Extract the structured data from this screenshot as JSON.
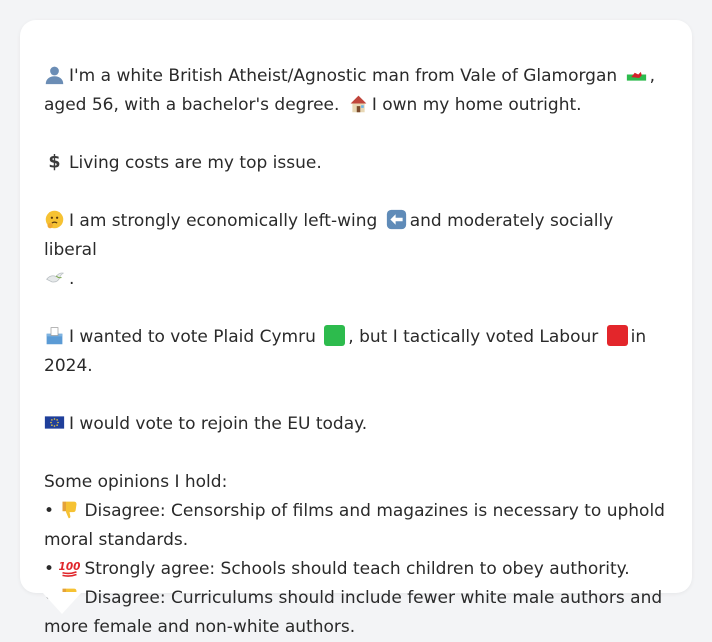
{
  "profile": {
    "line1_pre": "I'm a white British Atheist/Agnostic man from Vale of Glamorgan",
    "line1_post": ", aged 56, with a bachelor's degree.",
    "line1_home": "I own my home outright."
  },
  "issue": {
    "text": "Living costs are my top issue."
  },
  "ideology": {
    "pre": "I am strongly economically left-wing",
    "mid": "and moderately socially liberal",
    "post": "."
  },
  "vote": {
    "pre": "I wanted to vote Plaid Cymru",
    "mid": ", but I tactically voted Labour",
    "post": "in 2024.",
    "plaid_color": "#2dbb4d",
    "labour_color": "#e3262b"
  },
  "eu": {
    "text": "I would vote to rejoin the EU today."
  },
  "opinions": {
    "heading": "Some opinions I hold:",
    "items": [
      {
        "bullet": "•",
        "icon": "thumbs-down-icon",
        "stance": "Disagree:",
        "text": "Censorship of films and magazines is necessary to uphold moral standards."
      },
      {
        "bullet": "•",
        "icon": "hundred-points-icon",
        "stance": "Strongly agree:",
        "text": "Schools should teach children to obey authority."
      },
      {
        "bullet": "•",
        "icon": "thumbs-down-icon",
        "stance": "Disagree:",
        "text": "Curriculums should include fewer white male authors and more female and non-white authors."
      }
    ]
  }
}
